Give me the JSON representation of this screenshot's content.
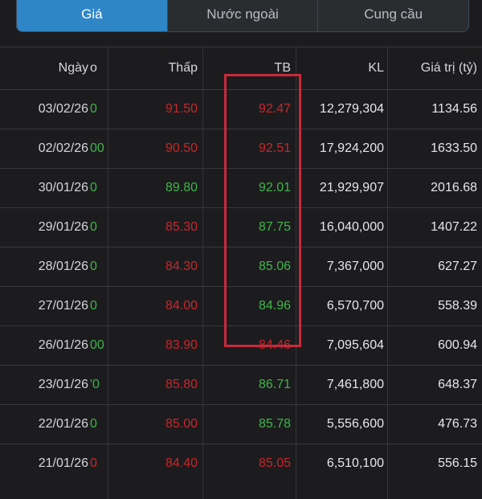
{
  "tabs": [
    {
      "label": "Giá",
      "active": true
    },
    {
      "label": "Nước ngoài",
      "active": false
    },
    {
      "label": "Cung cầu",
      "active": false
    }
  ],
  "columns": {
    "date": "Ngày",
    "clipped": "o",
    "low": "Thấp",
    "avg": "TB",
    "volume": "KL",
    "value": "Giá trị (tỷ)"
  },
  "colors": {
    "up": "#3fb54a",
    "down": "#c8262b",
    "tab_active": "#2f86c7",
    "highlight_box": "#c82a3b"
  },
  "rows": [
    {
      "date": "03/02/26",
      "clip": "0",
      "clip_color": "green",
      "low": "91.50",
      "low_color": "red",
      "avg": "92.47",
      "avg_color": "red",
      "volume": "12,279,304",
      "value": "1134.56"
    },
    {
      "date": "02/02/26",
      "clip": "00",
      "clip_color": "green",
      "low": "90.50",
      "low_color": "red",
      "avg": "92.51",
      "avg_color": "red",
      "volume": "17,924,200",
      "value": "1633.50"
    },
    {
      "date": "30/01/26",
      "clip": "0",
      "clip_color": "green",
      "low": "89.80",
      "low_color": "green",
      "avg": "92.01",
      "avg_color": "green",
      "volume": "21,929,907",
      "value": "2016.68"
    },
    {
      "date": "29/01/26",
      "clip": "0",
      "clip_color": "green",
      "low": "85.30",
      "low_color": "red",
      "avg": "87.75",
      "avg_color": "green",
      "volume": "16,040,000",
      "value": "1407.22"
    },
    {
      "date": "28/01/26",
      "clip": "0",
      "clip_color": "green",
      "low": "84.30",
      "low_color": "red",
      "avg": "85.06",
      "avg_color": "green",
      "volume": "7,367,000",
      "value": "627.27"
    },
    {
      "date": "27/01/26",
      "clip": "0",
      "clip_color": "green",
      "low": "84.00",
      "low_color": "red",
      "avg": "84.96",
      "avg_color": "green",
      "volume": "6,570,700",
      "value": "558.39"
    },
    {
      "date": "26/01/26",
      "clip": "00",
      "clip_color": "green",
      "low": "83.90",
      "low_color": "red",
      "avg": "84.46",
      "avg_color": "red",
      "volume": "7,095,604",
      "value": "600.94"
    },
    {
      "date": "23/01/26",
      "clip": "'0",
      "clip_color": "green",
      "low": "85.80",
      "low_color": "red",
      "avg": "86.71",
      "avg_color": "green",
      "volume": "7,461,800",
      "value": "648.37"
    },
    {
      "date": "22/01/26",
      "clip": "0",
      "clip_color": "green",
      "low": "85.00",
      "low_color": "red",
      "avg": "85.78",
      "avg_color": "green",
      "volume": "5,556,600",
      "value": "476.73"
    },
    {
      "date": "21/01/26",
      "clip": "0",
      "clip_color": "red",
      "low": "84.40",
      "low_color": "red",
      "avg": "85.05",
      "avg_color": "red",
      "volume": "6,510,100",
      "value": "556.15"
    }
  ]
}
